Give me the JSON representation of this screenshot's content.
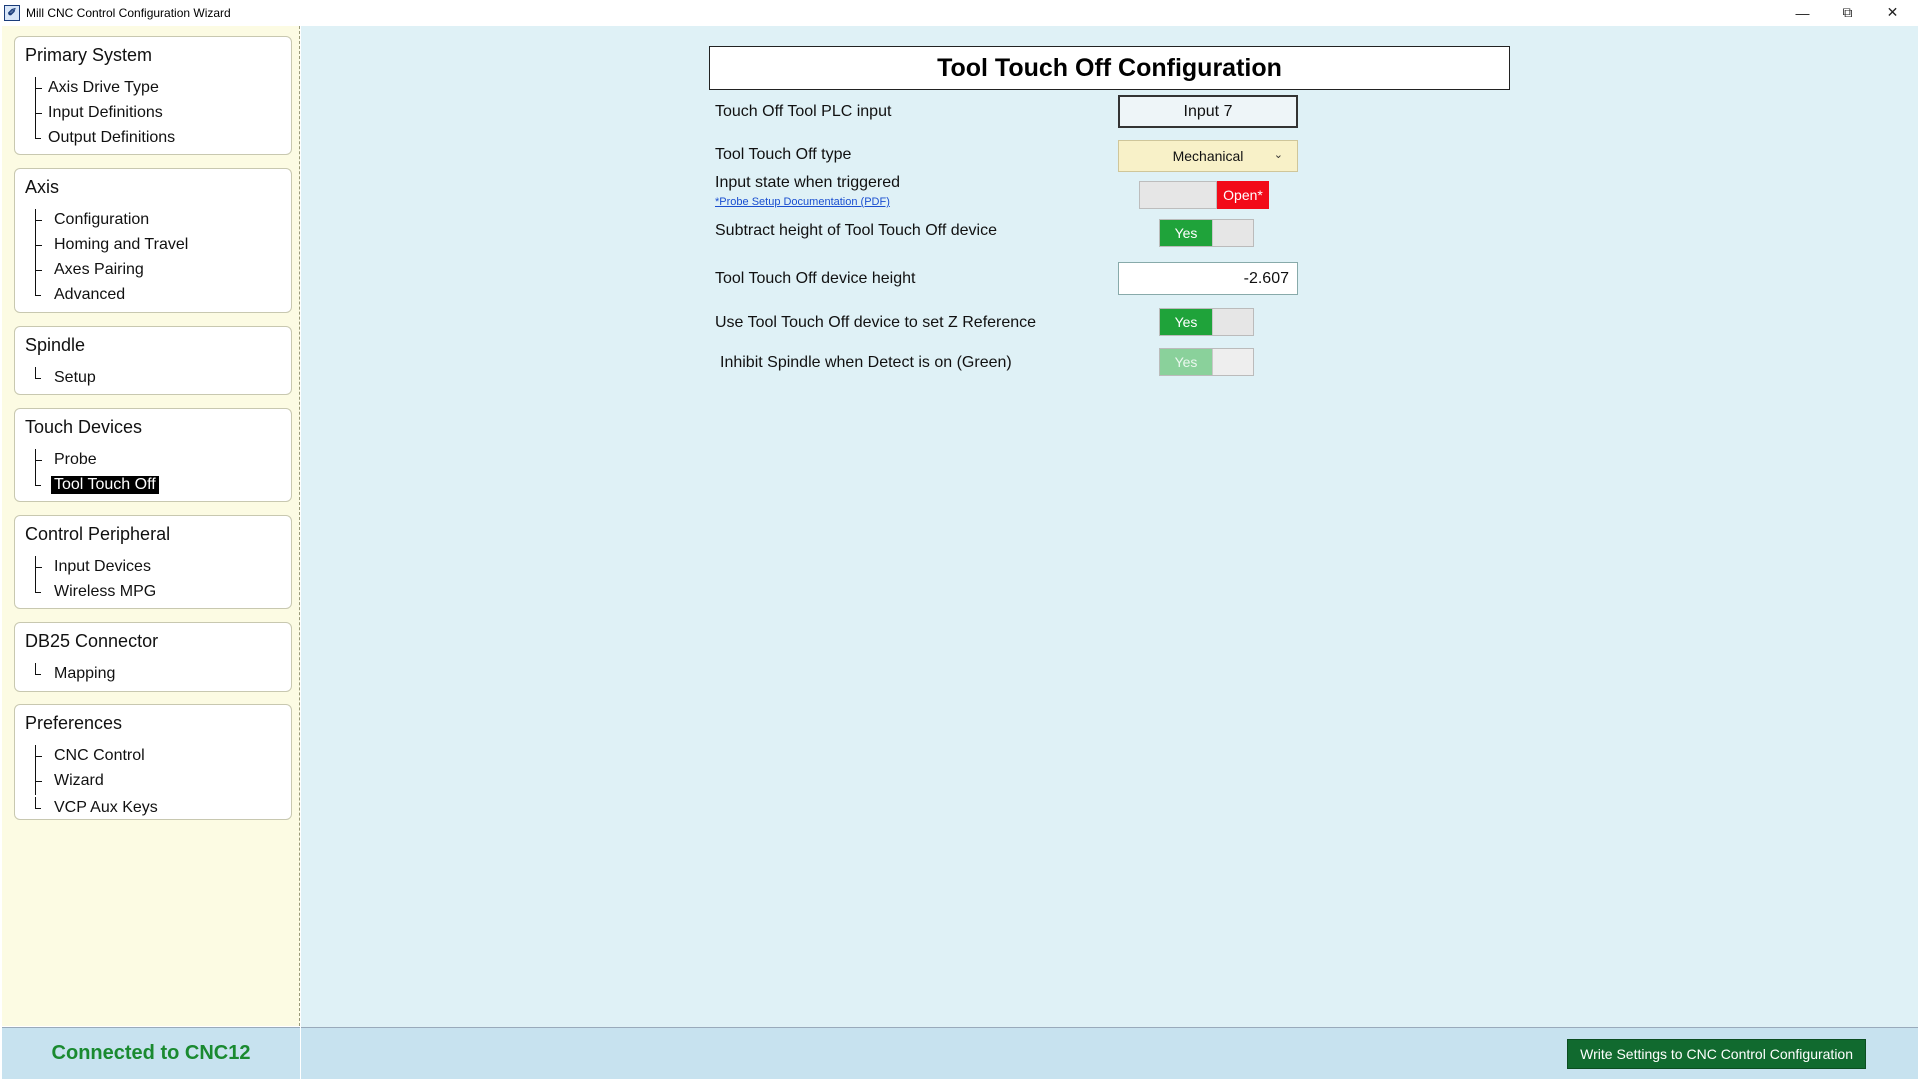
{
  "window": {
    "title": "Mill CNC Control Configuration Wizard",
    "minimize_icon": "minimize-icon",
    "restore_icon": "restore-icon",
    "close_icon": "close-icon"
  },
  "sidebar": {
    "groups": [
      {
        "title": "Primary System",
        "items": [
          "Axis Drive Type",
          "Input Definitions",
          "Output Definitions"
        ]
      },
      {
        "title": "Axis",
        "items": [
          "Configuration",
          "Homing and Travel",
          "Axes Pairing",
          "Advanced"
        ]
      },
      {
        "title": "Spindle",
        "items": [
          "Setup"
        ]
      },
      {
        "title": "Touch Devices",
        "items": [
          "Probe",
          "Tool Touch Off"
        ]
      },
      {
        "title": "Control Peripheral",
        "items": [
          "Input Devices",
          "Wireless MPG"
        ]
      },
      {
        "title": "DB25 Connector",
        "items": [
          "Mapping"
        ]
      },
      {
        "title": "Preferences",
        "items": [
          "CNC Control",
          "Wizard",
          "VCP Aux Keys"
        ]
      }
    ],
    "selected": "Tool Touch Off"
  },
  "main": {
    "heading": "Tool Touch Off Configuration",
    "plc_input_label": "Touch Off Tool PLC input",
    "plc_input_value": "Input 7",
    "type_label": "Tool Touch Off type",
    "type_value": "Mechanical",
    "input_state_label": "Input state when triggered",
    "probe_doc_link": "*Probe Setup Documentation (PDF)",
    "input_state_value": "Open*",
    "subtract_height_label": "Subtract height of Tool Touch Off device",
    "subtract_height_value": "Yes",
    "device_height_label": "Tool Touch Off device height",
    "device_height_value": "-2.607",
    "z_reference_label": "Use Tool Touch Off device to set Z Reference",
    "z_reference_value": "Yes",
    "inhibit_spindle_label": "Inhibit Spindle when Detect is on (Green)",
    "inhibit_spindle_value": "Yes"
  },
  "footer": {
    "status": "Connected to CNC12",
    "write_button": "Write Settings to CNC Control Configuration"
  },
  "colors": {
    "sidebar_bg": "#fcfbe3",
    "main_bg": "#dff1f6",
    "toggle_on": "#1fa33a",
    "toggle_open": "#f20a18",
    "status_text": "#1a8a30",
    "write_button_bg": "#116a2f"
  }
}
